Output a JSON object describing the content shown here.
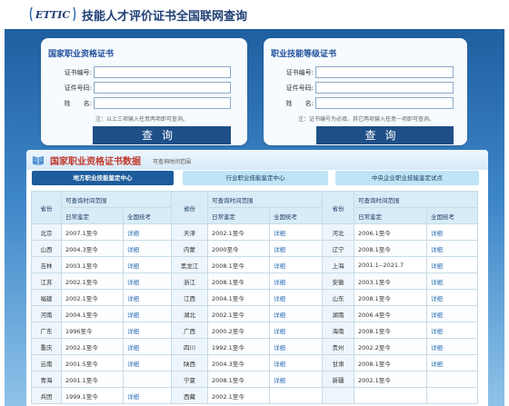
{
  "header": {
    "logo_text": "ETTIC",
    "title": "技能人才评价证书全国联网查询"
  },
  "left_panel": {
    "title": "国家职业资格证书",
    "fields": [
      {
        "label": "证书编号:",
        "value": ""
      },
      {
        "label": "证件号码:",
        "value": ""
      },
      {
        "label": "姓　　名:",
        "value": ""
      }
    ],
    "note": "注：以上三项输入任意两项即可查询。",
    "button": "查询"
  },
  "right_panel": {
    "title": "职业技能等级证书",
    "fields": [
      {
        "label": "证书编号:",
        "value": ""
      },
      {
        "label": "证件号码:",
        "value": ""
      },
      {
        "label": "姓　　名:",
        "value": ""
      }
    ],
    "note": "注：证书编号为必填，其它两项输入任意一项即可查询。",
    "button": "查询"
  },
  "data_section": {
    "title": "国家职业资格证书数据",
    "subtitle": "可查询时间范围",
    "tabs": [
      {
        "label": "地方职业技能鉴定中心",
        "active": true
      },
      {
        "label": "行业职业技能鉴定中心",
        "active": false
      },
      {
        "label": "中央企业职业技能鉴定试点",
        "active": false
      }
    ],
    "table": {
      "province_header": "省份",
      "range_header": "可查询时间范围",
      "sub_headers": [
        "日常鉴定",
        "全国统考"
      ],
      "detail_link": "详细",
      "rows": [
        [
          {
            "p": "北京",
            "d": "2007.1至今",
            "link": true
          },
          {
            "p": "天津",
            "d": "2002.1至今",
            "link": true
          },
          {
            "p": "河北",
            "d": "2006.1至今",
            "link": true
          }
        ],
        [
          {
            "p": "山西",
            "d": "2004.3至今",
            "link": true
          },
          {
            "p": "内蒙",
            "d": "2000至今",
            "link": true
          },
          {
            "p": "辽宁",
            "d": "2008.1至今",
            "link": true
          }
        ],
        [
          {
            "p": "吉林",
            "d": "2003.1至今",
            "link": true
          },
          {
            "p": "黑龙江",
            "d": "2008.1至今",
            "link": true
          },
          {
            "p": "上海",
            "d": "2001.1--2021.7",
            "link": true
          }
        ],
        [
          {
            "p": "江苏",
            "d": "2002.1至今",
            "link": true
          },
          {
            "p": "浙江",
            "d": "2008.1至今",
            "link": true
          },
          {
            "p": "安徽",
            "d": "2003.1至今",
            "link": true
          }
        ],
        [
          {
            "p": "福建",
            "d": "2002.1至今",
            "link": true
          },
          {
            "p": "江西",
            "d": "2004.1至今",
            "link": true
          },
          {
            "p": "山东",
            "d": "2008.1至今",
            "link": true
          }
        ],
        [
          {
            "p": "河南",
            "d": "2004.1至今",
            "link": true
          },
          {
            "p": "湖北",
            "d": "2002.1至今",
            "link": true
          },
          {
            "p": "湖南",
            "d": "2006.4至今",
            "link": true
          }
        ],
        [
          {
            "p": "广东",
            "d": "1996至今",
            "link": true
          },
          {
            "p": "广西",
            "d": "2000.2至今",
            "link": true
          },
          {
            "p": "海南",
            "d": "2008.1至今",
            "link": true
          }
        ],
        [
          {
            "p": "重庆",
            "d": "2002.1至今",
            "link": true
          },
          {
            "p": "四川",
            "d": "1992.1至今",
            "link": true
          },
          {
            "p": "贵州",
            "d": "2002.2至今",
            "link": true
          }
        ],
        [
          {
            "p": "云南",
            "d": "2001.5至今",
            "link": true
          },
          {
            "p": "陕西",
            "d": "2004.3至今",
            "link": true
          },
          {
            "p": "甘肃",
            "d": "2008.1至今",
            "link": true
          }
        ],
        [
          {
            "p": "青海",
            "d": "2001.1至今",
            "link": false
          },
          {
            "p": "宁夏",
            "d": "2008.1至今",
            "link": true
          },
          {
            "p": "新疆",
            "d": "2002.1至今",
            "link": false
          }
        ],
        [
          {
            "p": "兵团",
            "d": "1999.1至今",
            "link": true
          },
          {
            "p": "西藏",
            "d": "2002.1至今",
            "link": false
          },
          {
            "p": "",
            "d": "",
            "link": false
          }
        ]
      ]
    }
  },
  "colors": {
    "brand": "#1f3f73",
    "band_top": "#1f5fa0",
    "button": "#1e4f87",
    "link": "#2c6fb6",
    "title_red": "#c0392b"
  }
}
